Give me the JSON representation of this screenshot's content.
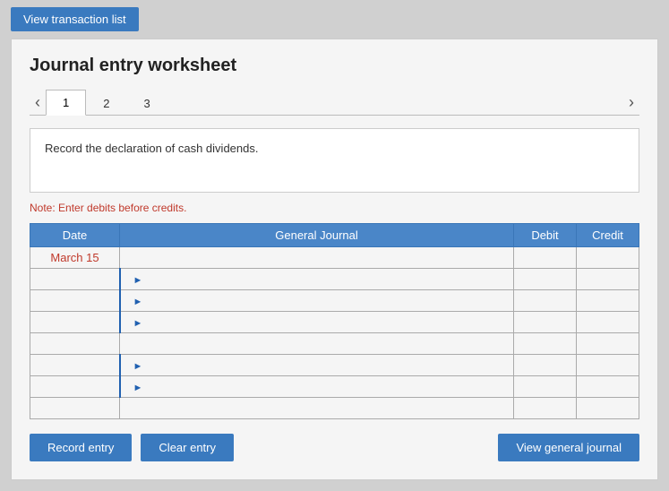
{
  "topBar": {
    "viewTransactionBtn": "View transaction list"
  },
  "panel": {
    "title": "Journal entry worksheet",
    "tabs": [
      {
        "label": "1",
        "active": true
      },
      {
        "label": "2",
        "active": false
      },
      {
        "label": "3",
        "active": false
      }
    ],
    "prevNav": "‹",
    "nextNav": "›",
    "description": "Record the declaration of cash dividends.",
    "note": "Note: Enter debits before credits.",
    "table": {
      "headers": [
        "Date",
        "General Journal",
        "Debit",
        "Credit"
      ],
      "rows": [
        {
          "date": "March 15",
          "journal": "",
          "debit": "",
          "credit": "",
          "indent": false
        },
        {
          "date": "",
          "journal": "",
          "debit": "",
          "credit": "",
          "indent": true
        },
        {
          "date": "",
          "journal": "",
          "debit": "",
          "credit": "",
          "indent": true
        },
        {
          "date": "",
          "journal": "",
          "debit": "",
          "credit": "",
          "indent": true
        },
        {
          "date": "",
          "journal": "",
          "debit": "",
          "credit": "",
          "indent": false
        },
        {
          "date": "",
          "journal": "",
          "debit": "",
          "credit": "",
          "indent": true
        },
        {
          "date": "",
          "journal": "",
          "debit": "",
          "credit": "",
          "indent": true
        },
        {
          "date": "",
          "journal": "",
          "debit": "",
          "credit": "",
          "indent": false
        }
      ]
    },
    "buttons": {
      "record": "Record entry",
      "clear": "Clear entry",
      "viewJournal": "View general journal"
    }
  }
}
